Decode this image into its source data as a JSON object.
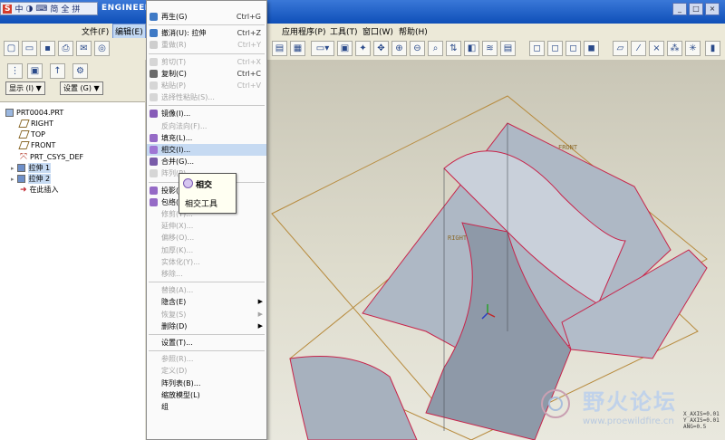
{
  "app": {
    "brand": "ENGINEER",
    "ime_labels": [
      "S",
      "中",
      "半月",
      "⌨",
      "简",
      "全",
      "拼"
    ]
  },
  "menubar": [
    {
      "label": "文件(F)",
      "active": false
    },
    {
      "label": "编辑(E)",
      "active": true
    },
    {
      "label": "应用程序(P)",
      "active": false
    },
    {
      "label": "工具(T)",
      "active": false
    },
    {
      "label": "窗口(W)",
      "active": false
    },
    {
      "label": "帮助(H)",
      "active": false
    }
  ],
  "left_panel": {
    "display_button": "显示 (I) ▼",
    "settings_button": "设置 (G) ▼",
    "tree": [
      {
        "label": "PRT0004.PRT",
        "icon": "part-icon"
      },
      {
        "label": "RIGHT",
        "icon": "datum-plane-icon"
      },
      {
        "label": "TOP",
        "icon": "datum-plane-icon"
      },
      {
        "label": "FRONT",
        "icon": "datum-plane-icon"
      },
      {
        "label": "PRT_CSYS_DEF",
        "icon": "csys-icon"
      },
      {
        "label": "拉伸 1",
        "icon": "extrude-icon"
      },
      {
        "label": "拉伸 2",
        "icon": "extrude-icon"
      },
      {
        "label": "在此插入",
        "icon": "insert-arrow-icon"
      }
    ]
  },
  "edit_menu": {
    "items": [
      {
        "label": "再生(G)",
        "shortcut": "Ctrl+G",
        "disabled": false,
        "icon": "regenerate-icon"
      },
      {
        "sep": true
      },
      {
        "label": "撤消(U): 拉伸",
        "shortcut": "Ctrl+Z",
        "disabled": false,
        "icon": "undo-icon"
      },
      {
        "label": "重做(R)",
        "shortcut": "Ctrl+Y",
        "disabled": true,
        "icon": "redo-icon"
      },
      {
        "sep": true
      },
      {
        "label": "剪切(T)",
        "shortcut": "Ctrl+X",
        "disabled": true,
        "icon": "cut-icon"
      },
      {
        "label": "复制(C)",
        "shortcut": "Ctrl+C",
        "disabled": false,
        "icon": "copy-icon"
      },
      {
        "label": "粘贴(P)",
        "shortcut": "Ctrl+V",
        "disabled": true,
        "icon": "paste-icon"
      },
      {
        "label": "选择性粘贴(S)...",
        "shortcut": "",
        "disabled": true,
        "icon": "paste-special-icon"
      },
      {
        "sep": true
      },
      {
        "label": "镜像(I)...",
        "shortcut": "",
        "disabled": false,
        "icon": "mirror-icon"
      },
      {
        "label": "反向法向(F)...",
        "shortcut": "",
        "disabled": true,
        "icon": ""
      },
      {
        "label": "填充(L)...",
        "shortcut": "",
        "disabled": false,
        "icon": "fill-icon"
      },
      {
        "label": "相交(I)...",
        "shortcut": "",
        "disabled": false,
        "highlight": true,
        "icon": "intersect-icon"
      },
      {
        "label": "合并(G)...",
        "shortcut": "",
        "disabled": false,
        "icon": "merge-icon"
      },
      {
        "label": "阵列(P)...",
        "shortcut": "",
        "disabled": true,
        "icon": "pattern-icon"
      },
      {
        "sep": true
      },
      {
        "label": "投影(J)...",
        "shortcut": "",
        "disabled": false,
        "icon": "project-icon"
      },
      {
        "label": "包络(N)...",
        "shortcut": "",
        "disabled": false,
        "icon": "wrap-icon"
      },
      {
        "label": "修剪(T)...",
        "shortcut": "",
        "disabled": true,
        "icon": ""
      },
      {
        "label": "延伸(X)...",
        "shortcut": "",
        "disabled": true,
        "icon": ""
      },
      {
        "label": "偏移(O)...",
        "shortcut": "",
        "disabled": true,
        "icon": ""
      },
      {
        "label": "加厚(K)...",
        "shortcut": "",
        "disabled": true,
        "icon": ""
      },
      {
        "label": "实体化(Y)...",
        "shortcut": "",
        "disabled": true,
        "icon": ""
      },
      {
        "label": "移除...",
        "shortcut": "",
        "disabled": true,
        "icon": ""
      },
      {
        "sep": true
      },
      {
        "label": "替换(A)...",
        "shortcut": "",
        "disabled": true,
        "icon": ""
      },
      {
        "label": "隐含(E)",
        "shortcut": "",
        "disabled": false,
        "submenu": true,
        "icon": ""
      },
      {
        "label": "恢复(S)",
        "shortcut": "",
        "disabled": true,
        "submenu": true,
        "icon": ""
      },
      {
        "label": "删除(D)",
        "shortcut": "",
        "disabled": false,
        "submenu": true,
        "icon": ""
      },
      {
        "sep": true
      },
      {
        "label": "设置(T)...",
        "shortcut": "",
        "disabled": false,
        "icon": ""
      },
      {
        "sep": true
      },
      {
        "label": "参照(R)...",
        "shortcut": "",
        "disabled": true,
        "icon": ""
      },
      {
        "label": "定义(D)",
        "shortcut": "",
        "disabled": true,
        "icon": ""
      },
      {
        "label": "阵列表(B)...",
        "shortcut": "",
        "disabled": false,
        "icon": ""
      },
      {
        "label": "缩放模型(L)",
        "shortcut": "",
        "disabled": false,
        "icon": ""
      },
      {
        "label": "组",
        "shortcut": "",
        "disabled": false,
        "icon": ""
      }
    ]
  },
  "tooltip": {
    "title": "相交",
    "description": "相交工具"
  },
  "viewport": {
    "datum_labels": [
      "FRONT",
      "RIGHT"
    ],
    "status_lines": [
      "X_AXIS=0.01",
      "Y_AXIS=0.01",
      "ANG=0.5"
    ],
    "surface_color": "#b7c0cc",
    "edge_color": "#c8234a",
    "datum_color": "#b78a3c"
  },
  "watermark": {
    "text": "野火论坛",
    "url": "www.proewildfire.cn"
  }
}
